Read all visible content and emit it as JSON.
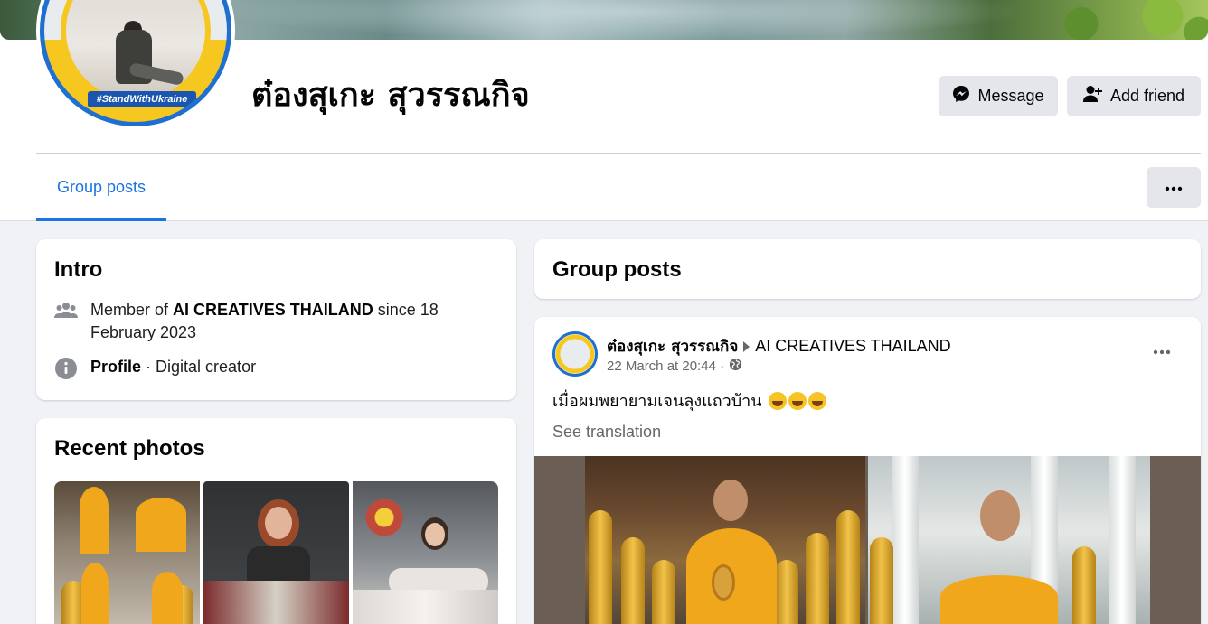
{
  "profile": {
    "name": "ต๋องสุเกะ สุวรรณกิจ",
    "avatar_tag": "#StandWithUkraine"
  },
  "actions": {
    "message_label": "Message",
    "add_friend_label": "Add friend"
  },
  "tabs": [
    {
      "label": "Group posts",
      "active": true
    }
  ],
  "intro": {
    "title": "Intro",
    "member_prefix": "Member of",
    "group_name": "AI CREATIVES THAILAND",
    "member_since": "since 18 February 2023",
    "profile_label": "Profile",
    "profile_category": "· Digital creator"
  },
  "recent_photos": {
    "title": "Recent photos"
  },
  "group_posts": {
    "title": "Group posts"
  },
  "post": {
    "author": "ต๋องสุเกะ สุวรรณกิจ",
    "group": "AI CREATIVES THAILAND",
    "timestamp": "22 March at 20:44 ·",
    "text": "เมื่อผมพยายามเจนลุงแถวบ้าน",
    "see_translation": "See translation"
  },
  "colors": {
    "accent": "#1b74e4",
    "button_bg": "#e4e6eb",
    "page_bg": "#f0f2f5",
    "secondary_text": "#65676b"
  }
}
